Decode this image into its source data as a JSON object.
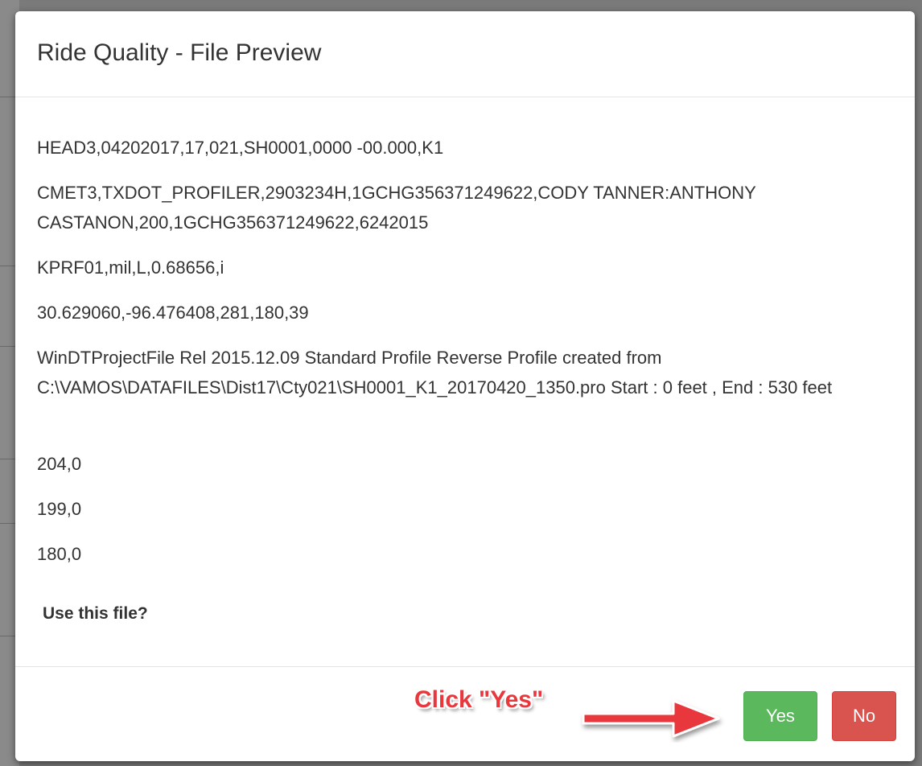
{
  "dialog": {
    "title": "Ride Quality - File Preview"
  },
  "preview": {
    "lines": [
      "HEAD3,04202017,17,021,SH0001,0000 -00.000,K1",
      "CMET3,TXDOT_PROFILER,2903234H,1GCHG356371249622,CODY TANNER:ANTHONY CASTANON,200,1GCHG356371249622,6242015",
      "KPRF01,mil,L,0.68656,i",
      "30.629060,-96.476408,281,180,39",
      "WinDTProjectFile Rel 2015.12.09 Standard Profile Reverse Profile created from C:\\VAMOS\\DATAFILES\\Dist17\\Cty021\\SH0001_K1_20170420_1350.pro Start : 0 feet , End : 530 feet",
      "204,0",
      "199,0",
      "180,0"
    ]
  },
  "prompt": {
    "text": "Use this file?"
  },
  "footer": {
    "yes_label": "Yes",
    "no_label": "No"
  },
  "annotation": {
    "text": "Click \"Yes\"",
    "icon": "arrow-right-icon"
  },
  "colors": {
    "yes": "#5cb85c",
    "no": "#d9534f",
    "annotation": "#e8383d"
  }
}
